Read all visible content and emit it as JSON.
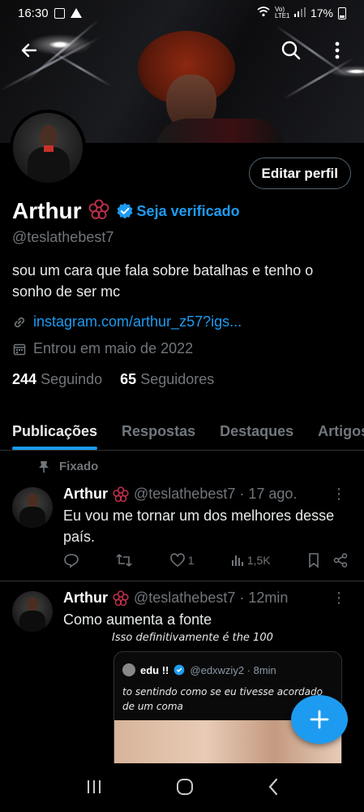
{
  "status_bar": {
    "time": "16:30",
    "network": "Vo) LTE1",
    "battery": "17%"
  },
  "profile": {
    "name": "Arthur",
    "verify_prompt": "Seja verificado",
    "handle": "@teslathebest7",
    "bio": "sou um cara que fala sobre batalhas e tenho o sonho de ser mc",
    "link": "instagram.com/arthur_z57?igs...",
    "joined": "Entrou em maio de 2022",
    "following_count": "244",
    "following_label": "Seguindo",
    "followers_count": "65",
    "followers_label": "Seguidores",
    "edit_label": "Editar perfil"
  },
  "tabs": [
    "Publicações",
    "Respostas",
    "Destaques",
    "Artigos"
  ],
  "pinned_label": "Fixado",
  "posts": [
    {
      "name": "Arthur",
      "meta": "@teslathebest7 · 17 ago.",
      "text": "Eu vou me tornar um dos melhores desse país.",
      "likes": "1",
      "views": "1,5K"
    },
    {
      "name": "Arthur",
      "meta": "@teslathebest7 · 12min",
      "text": "Como aumenta a fonte",
      "media": {
        "caption": "Isso definitivamente é the 100",
        "quote_name": "edu !!",
        "quote_handle": "@edxwziy2 · 8min",
        "quote_text": "to sentindo como se eu tivesse acordado de um coma"
      }
    }
  ],
  "colors": {
    "accent": "#1d9bf0",
    "muted": "#71767b",
    "background": "#000000"
  }
}
